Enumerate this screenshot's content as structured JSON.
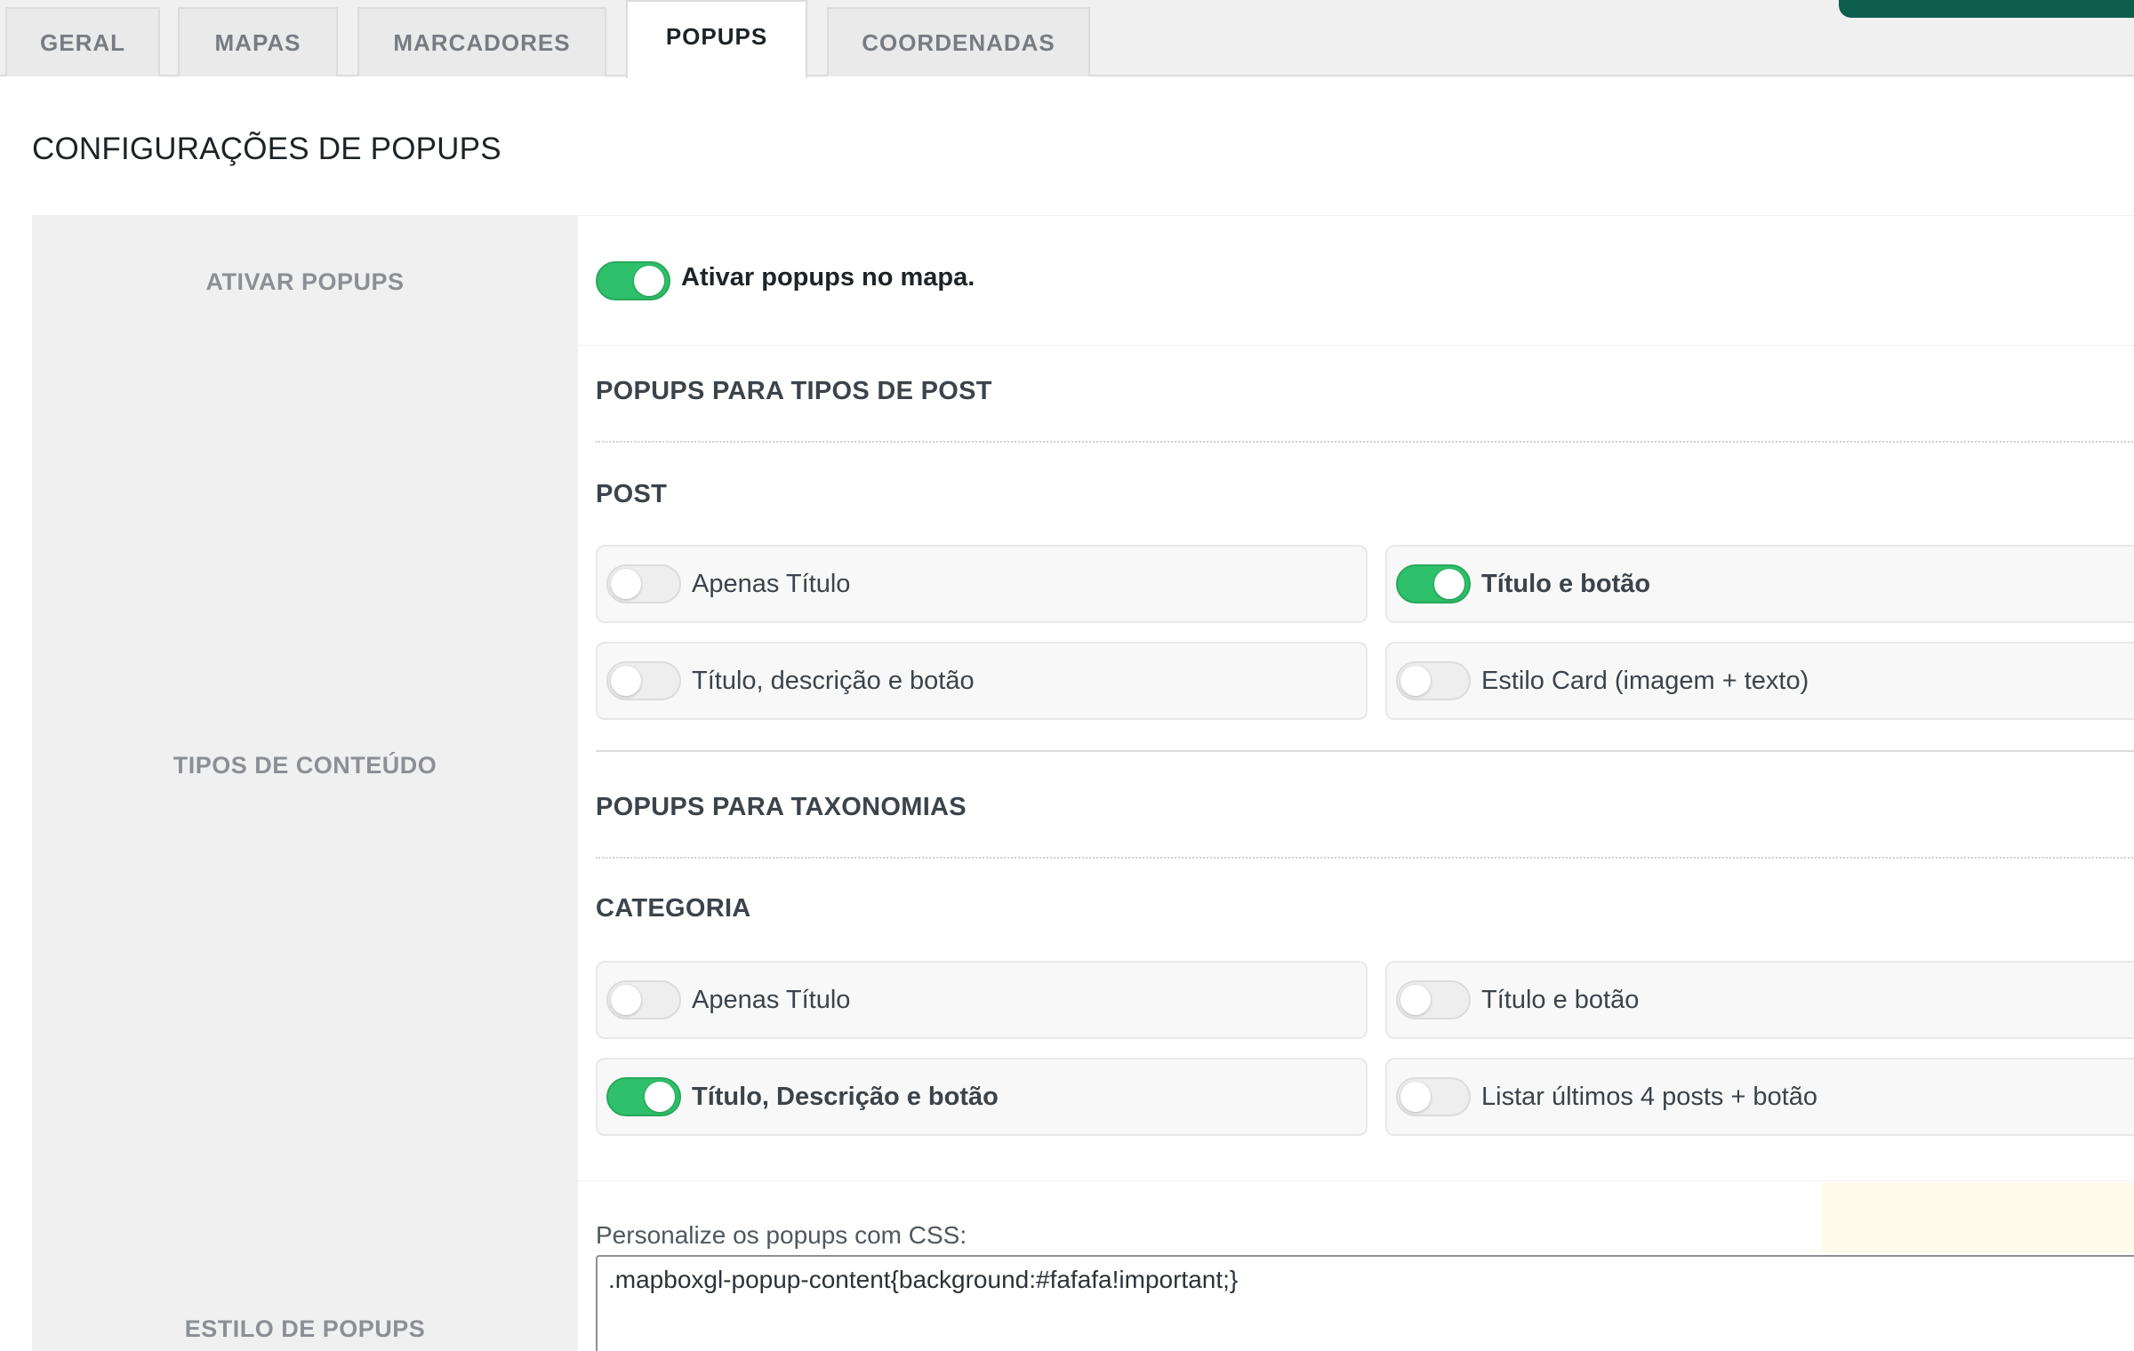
{
  "tabs": [
    {
      "label": "GERAL",
      "active": false
    },
    {
      "label": "MAPAS",
      "active": false
    },
    {
      "label": "MARCADORES",
      "active": false
    },
    {
      "label": "POPUPS",
      "active": true
    },
    {
      "label": "COORDENADAS",
      "active": false
    }
  ],
  "page_title": "CONFIGURAÇÕES DE POPUPS",
  "rows": {
    "enable": {
      "label": "ATIVAR POPUPS",
      "toggle_label": "Ativar popups no mapa.",
      "enabled": true
    },
    "content_types": {
      "label": "TIPOS DE CONTEÚDO",
      "post_types_heading": "POPUPS PARA TIPOS DE POST",
      "post_heading": "POST",
      "post_options": [
        {
          "label": "Apenas Título",
          "checked": false
        },
        {
          "label": "Título e botão",
          "checked": true
        },
        {
          "label": "Título, descrição e botão",
          "checked": false
        },
        {
          "label": "Estilo Card (imagem + texto)",
          "checked": false
        }
      ],
      "taxonomies_heading": "POPUPS PARA TAXONOMIAS",
      "category_heading": "CATEGORIA",
      "category_options": [
        {
          "label": "Apenas Título",
          "checked": false
        },
        {
          "label": "Título e botão",
          "checked": false
        },
        {
          "label": "Título, Descrição e botão",
          "checked": true
        },
        {
          "label": "Listar últimos 4 posts + botão",
          "checked": false
        }
      ]
    },
    "style": {
      "label": "ESTILO DE POPUPS",
      "css_hint": "Personalize os popups com CSS:",
      "css_value": ".mapboxgl-popup-content{background:#fafafa!important;}"
    }
  },
  "colors": {
    "toggle_on": "#2ec06a",
    "accent": "#0e5e4f",
    "label_column_bg": "#f0f0f0"
  }
}
